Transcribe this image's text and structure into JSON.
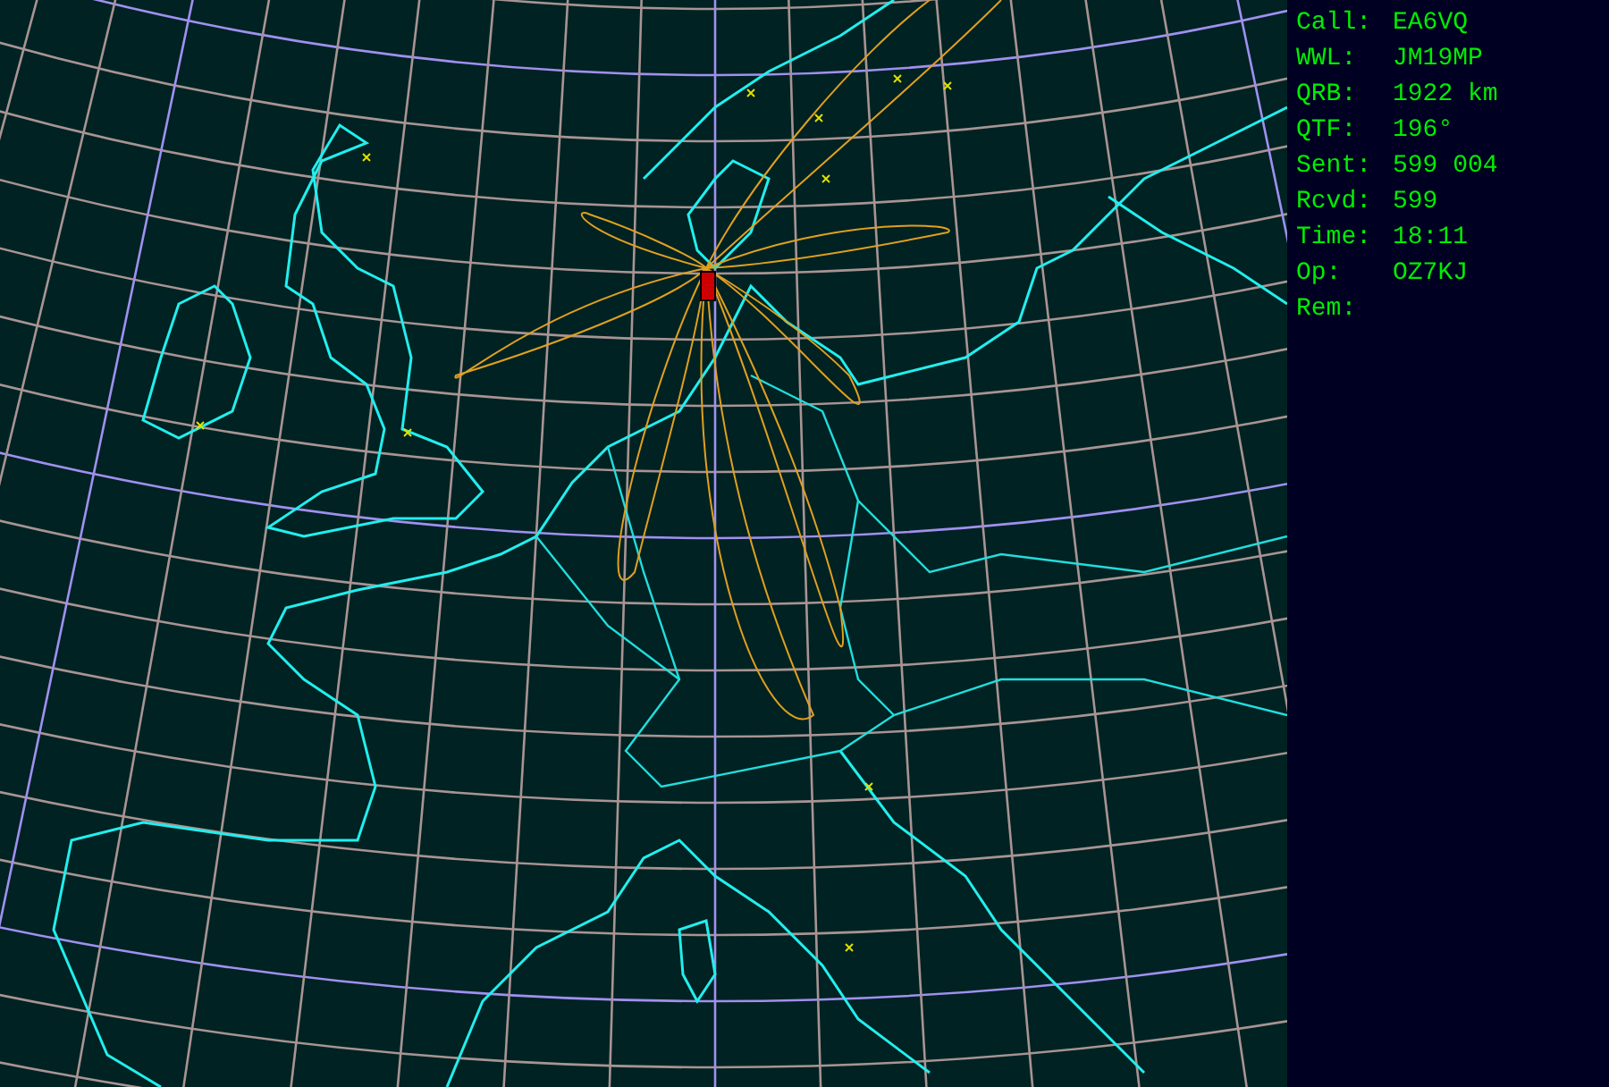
{
  "contact_info": [
    {
      "label": "Call:",
      "value": "EA6VQ"
    },
    {
      "label": "WWL:",
      "value": "JM19MP"
    },
    {
      "label": "QRB:",
      "value": "1922 km"
    },
    {
      "label": "QTF:",
      "value": "196°"
    },
    {
      "label": "Sent:",
      "value": "599 004"
    },
    {
      "label": "Rcvd:",
      "value": "599"
    },
    {
      "label": "Time:",
      "value": "18:11"
    },
    {
      "label": "Op:",
      "value": "OZ7KJ"
    },
    {
      "label": "Rem:"
    }
  ]
}
